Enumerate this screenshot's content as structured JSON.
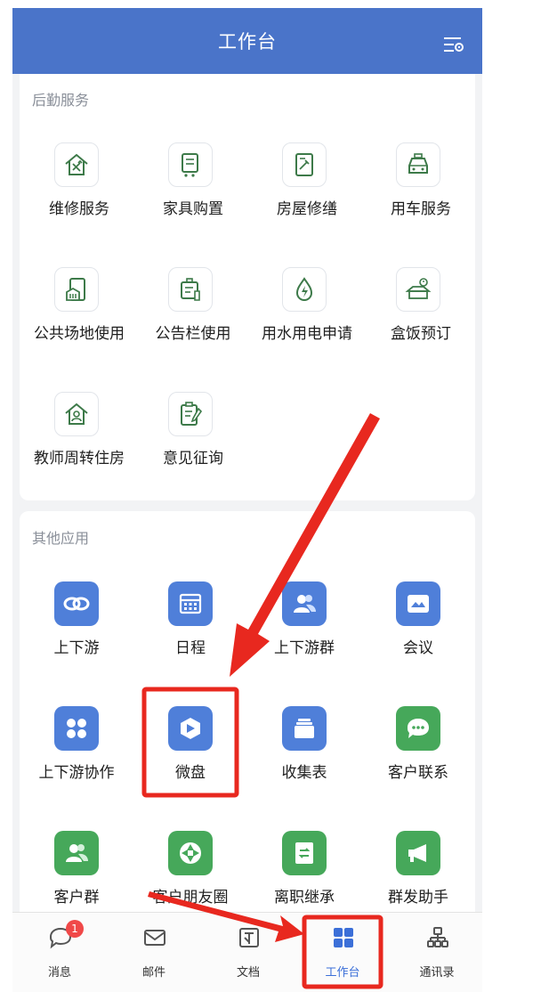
{
  "header": {
    "title": "工作台"
  },
  "logistics": {
    "title": "后勤服务",
    "items": [
      {
        "label": "维修服务",
        "icon": "repair-house-icon"
      },
      {
        "label": "家具购置",
        "icon": "furniture-cart-icon"
      },
      {
        "label": "房屋修缮",
        "icon": "building-repair-icon"
      },
      {
        "label": "用车服务",
        "icon": "car-icon"
      },
      {
        "label": "公共场地使用",
        "icon": "public-venue-icon"
      },
      {
        "label": "公告栏使用",
        "icon": "bulletin-board-icon"
      },
      {
        "label": "用水用电申请",
        "icon": "water-electric-icon"
      },
      {
        "label": "盒饭预订",
        "icon": "lunchbox-icon"
      },
      {
        "label": "教师周转住房",
        "icon": "teacher-housing-icon"
      },
      {
        "label": "意见征询",
        "icon": "feedback-clipboard-icon"
      }
    ]
  },
  "other": {
    "title": "其他应用",
    "items": [
      {
        "label": "上下游",
        "icon": "link-icon"
      },
      {
        "label": "日程",
        "icon": "calendar-icon"
      },
      {
        "label": "上下游群",
        "icon": "group-icon"
      },
      {
        "label": "会议",
        "icon": "meeting-icon"
      },
      {
        "label": "上下游协作",
        "icon": "grid-apps-icon"
      },
      {
        "label": "微盘",
        "icon": "cloud-drive-icon"
      },
      {
        "label": "收集表",
        "icon": "form-collect-icon"
      },
      {
        "label": "客户联系",
        "icon": "chat-bubble-icon"
      },
      {
        "label": "客户群",
        "icon": "customer-group-icon"
      },
      {
        "label": "客户朋友圈",
        "icon": "shutter-icon"
      },
      {
        "label": "离职继承",
        "icon": "transfer-icon"
      },
      {
        "label": "群发助手",
        "icon": "megaphone-icon"
      }
    ]
  },
  "tabbar": {
    "tabs": [
      {
        "label": "消息",
        "icon": "message-icon",
        "badge": "1"
      },
      {
        "label": "邮件",
        "icon": "mail-icon"
      },
      {
        "label": "文档",
        "icon": "document-icon"
      },
      {
        "label": "工作台",
        "icon": "workbench-icon",
        "active": true
      },
      {
        "label": "通讯录",
        "icon": "contacts-icon"
      }
    ]
  },
  "colors": {
    "header": "#4a74c9",
    "accent_blue": "#4f7fd9",
    "accent_green": "#46a85a",
    "outline_icon": "#3d7a49",
    "annotation_red": "#e8281f"
  }
}
